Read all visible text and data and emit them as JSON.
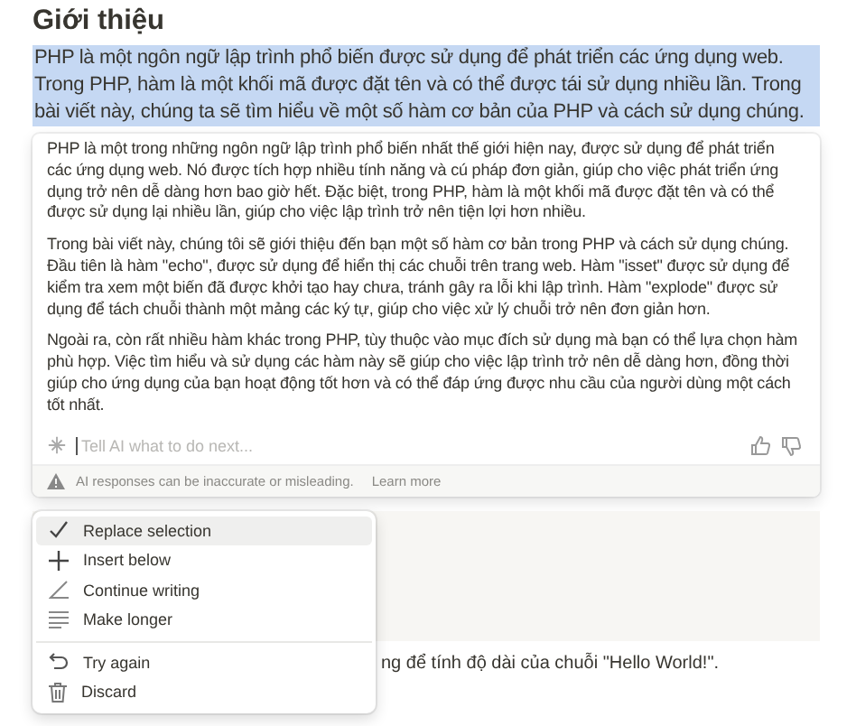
{
  "heading": "Giới thiệu",
  "selected_paragraph": "PHP là một ngôn ngữ lập trình phổ biến được sử dụng để phát triển các ứng dụng web. Trong PHP, hàm là một khối mã được đặt tên và có thể được tái sử dụng nhiều lần. Trong bài viết này, chúng ta sẽ tìm hiểu về một số hàm cơ bản của PHP và cách sử dụng chúng.",
  "ai_panel": {
    "paragraphs": [
      "PHP là một trong những ngôn ngữ lập trình phổ biến nhất thế giới hiện nay, được sử dụng để phát triển các ứng dụng web. Nó được tích hợp nhiều tính năng và cú pháp đơn giản, giúp cho việc phát triển ứng dụng trở nên dễ dàng hơn bao giờ hết. Đặc biệt, trong PHP, hàm là một khối mã được đặt tên và có thể được sử dụng lại nhiều lần, giúp cho việc lập trình trở nên tiện lợi hơn nhiều.",
      "Trong bài viết này, chúng tôi sẽ giới thiệu đến bạn một số hàm cơ bản trong PHP và cách sử dụng chúng. Đầu tiên là hàm \"echo\", được sử dụng để hiển thị các chuỗi trên trang web. Hàm \"isset\" được sử dụng để kiểm tra xem một biến đã được khởi tạo hay chưa, tránh gây ra lỗi khi lập trình. Hàm \"explode\" được sử dụng để tách chuỗi thành một mảng các ký tự, giúp cho việc xử lý chuỗi trở nên đơn giản hơn.",
      "Ngoài ra, còn rất nhiều hàm khác trong PHP, tùy thuộc vào mục đích sử dụng mà bạn có thể lựa chọn hàm phù hợp. Việc tìm hiểu và sử dụng các hàm này sẽ giúp cho việc lập trình trở nên dễ dàng hơn, đồng thời giúp cho ứng dụng của bạn hoạt động tốt hơn và có thể đáp ứng được nhu cầu của người dùng một cách tốt nhất."
    ],
    "prompt": {
      "placeholder": "Tell AI what to do next..."
    },
    "disclaimer": "AI responses can be inaccurate or misleading.",
    "learn_more": "Learn more"
  },
  "menu": {
    "groups": [
      [
        {
          "label": "Replace selection",
          "selected": true
        },
        {
          "label": "Insert below",
          "selected": false
        },
        {
          "label": "Continue writing",
          "selected": false
        },
        {
          "label": "Make longer",
          "selected": false
        }
      ],
      [
        {
          "label": "Try again",
          "selected": false
        },
        {
          "label": "Discard",
          "selected": false
        }
      ]
    ]
  },
  "partial_line": "ng để tính độ dài của chuỗi \"Hello World!\"."
}
